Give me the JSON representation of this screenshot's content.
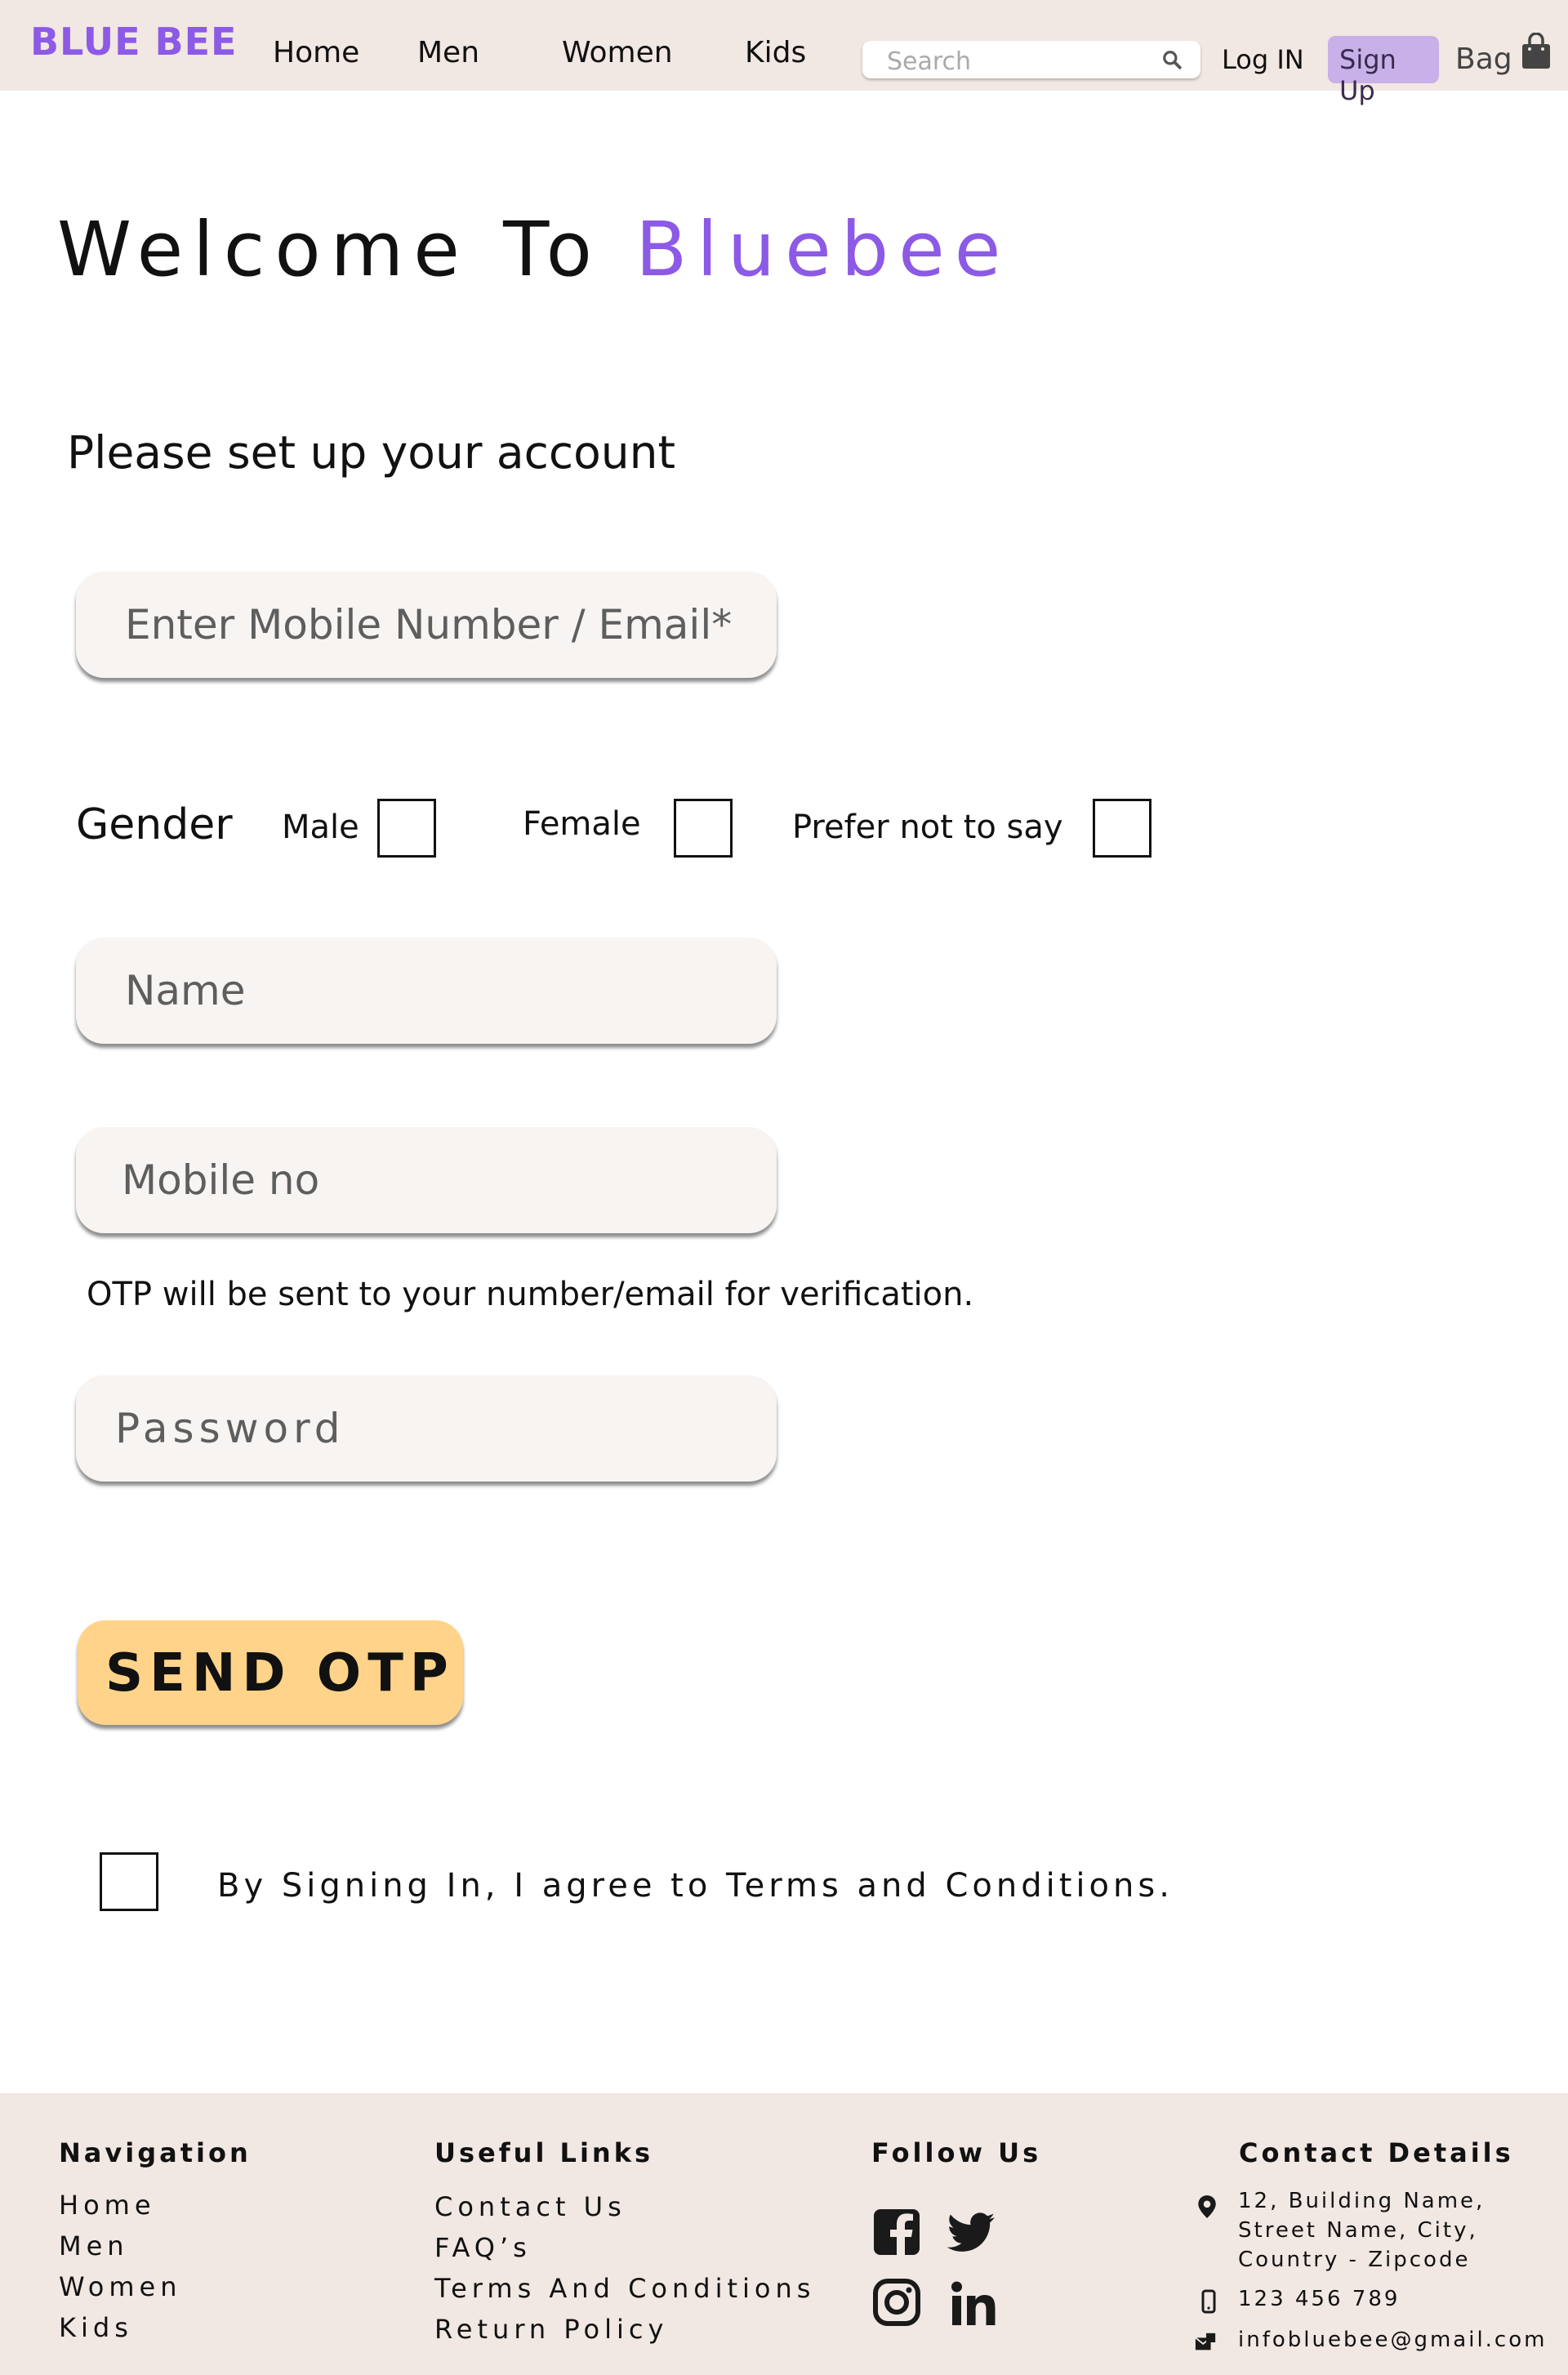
{
  "header": {
    "logo": "BLUE BEE",
    "nav": [
      "Home",
      "Men",
      "Women",
      "Kids"
    ],
    "search_placeholder": "Search",
    "login": "Log IN",
    "signup": "Sign Up",
    "bag": "Bag"
  },
  "main": {
    "title_prefix": "Welcome To",
    "title_accent": "Bluebee",
    "subtitle": "Please set up your account",
    "mobile_email_placeholder": "Enter Mobile Number / Email*",
    "gender": {
      "label": "Gender",
      "options": [
        "Male",
        "Female",
        "Prefer not to say"
      ]
    },
    "name_placeholder": "Name",
    "mobile_placeholder": "Mobile no",
    "otp_note": "OTP will be sent to your number/email for verification.",
    "password_placeholder": "Password",
    "send_otp": "SEND OTP",
    "terms": "By Signing In, I agree to Terms and Conditions."
  },
  "footer": {
    "navigation": {
      "title": "Navigation",
      "links": [
        "Home",
        "Men",
        "Women",
        "Kids"
      ]
    },
    "useful_links": {
      "title": "Useful  Links",
      "links": [
        "Contact Us",
        "FAQ’s",
        "Terms And Conditions",
        "Return Policy"
      ]
    },
    "follow_us": {
      "title": "Follow Us",
      "icons": [
        "facebook-icon",
        "twitter-icon",
        "instagram-icon",
        "linkedin-icon"
      ]
    },
    "contact": {
      "title": "Contact Details",
      "address": "12, Building Name, Street Name, City, Country - Zipcode",
      "phone": "123 456 789",
      "email": "infobluebee@gmail.com"
    }
  },
  "colors": {
    "accent": "#8c5ae6",
    "header_bg": "#f1e7e3",
    "signup_bg": "#c8b0e8",
    "button_bg": "#ffd389"
  }
}
